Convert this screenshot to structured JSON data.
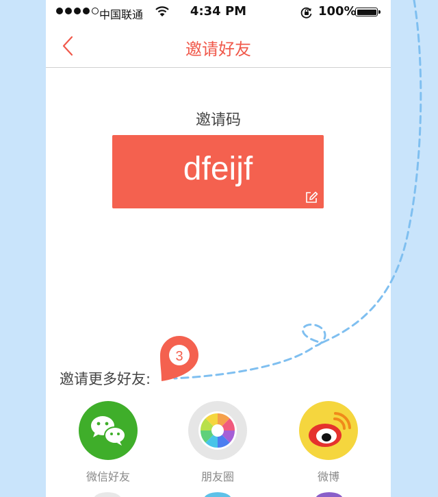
{
  "status_bar": {
    "carrier": "中国联通",
    "time": "4:34 PM",
    "battery": "100%"
  },
  "nav": {
    "title": "邀请好友"
  },
  "invite": {
    "code_label": "邀请码",
    "code": "dfeijf"
  },
  "step_marker": "3",
  "share": {
    "label": "邀请更多好友:",
    "items": [
      {
        "label": "微信好友",
        "icon": "wechat-icon",
        "color": "#3fae2a"
      },
      {
        "label": "朋友圈",
        "icon": "moments-icon",
        "color": "#e6e6e6"
      },
      {
        "label": "微博",
        "icon": "weibo-icon",
        "color": "#f5d63e"
      }
    ]
  },
  "colors": {
    "accent": "#f0584a",
    "code_bg": "#f4614f",
    "page_bg": "#c9e4fb",
    "dashed_line": "#7fbff0"
  }
}
